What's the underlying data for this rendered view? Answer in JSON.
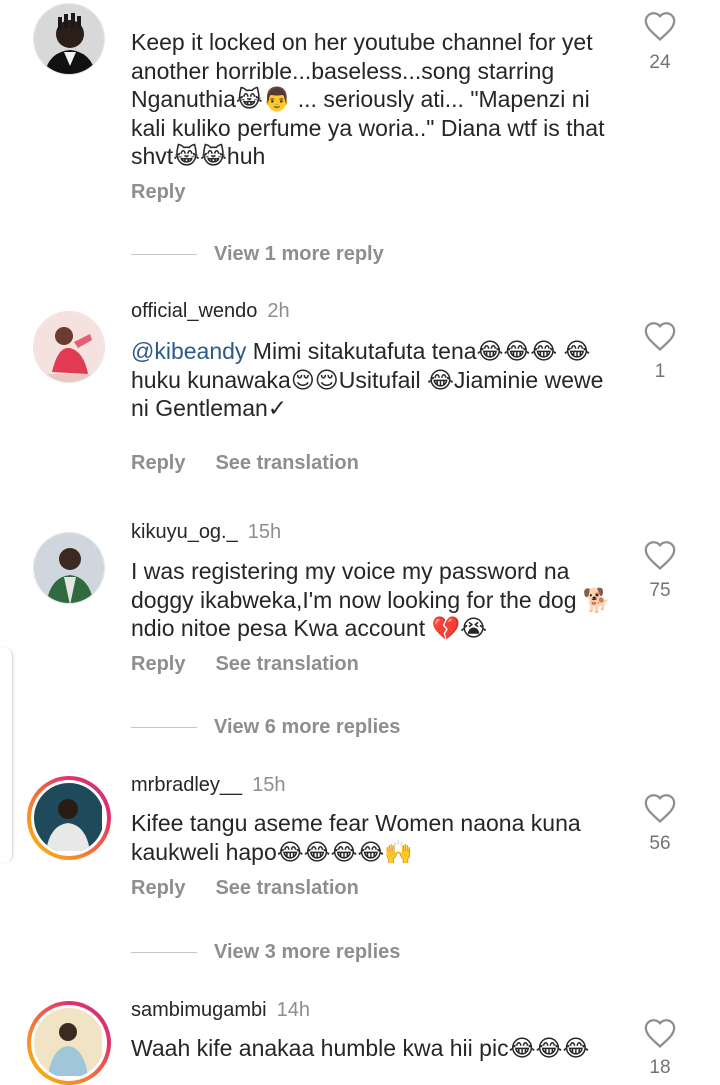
{
  "comments": [
    {
      "username": "",
      "time": "",
      "text": "Keep it locked on her youtube channel for yet another horrible...baseless...song starring Nganuthia😹👨 ... seriously ati... \"Mapenzi ni kali kuliko perfume ya woria..\" Diana wtf is that shvt😹😹huh",
      "likes": "24",
      "reply_label": "Reply",
      "translate_label": "",
      "view_more": "View 1 more reply"
    },
    {
      "username": "official_wendo",
      "time": "2h",
      "mention": "@kibeandy",
      "text": " Mimi sitakutafuta tena😂😂😂 😂 huku kunawaka😌😌Usitufail 😂Jiaminie wewe ni Gentleman✓",
      "likes": "1",
      "reply_label": "Reply",
      "translate_label": "See translation",
      "view_more": ""
    },
    {
      "username": "kikuyu_og._",
      "time": "15h",
      "text": "I was registering my voice my password na doggy ikabweka,I'm now looking for the dog 🐕 ndio nitoe pesa Kwa account 💔😭",
      "likes": "75",
      "reply_label": "Reply",
      "translate_label": "See translation",
      "view_more": "View 6 more replies"
    },
    {
      "username": "mrbradley__",
      "time": "15h",
      "text": "Kifee tangu aseme fear Women naona kuna kaukweli hapo😂😂😂😂🙌",
      "likes": "56",
      "reply_label": "Reply",
      "translate_label": "See translation",
      "view_more": "View 3 more replies"
    },
    {
      "username": "sambimugambi",
      "time": "14h",
      "text": "Waah kife anakaa humble kwa hii pic😂😂😂",
      "likes": "18",
      "reply_label": "",
      "translate_label": "",
      "view_more": ""
    }
  ],
  "icons": {
    "like": "heart-outline-icon",
    "avatar": "profile-picture"
  },
  "colors": {
    "text": "#262626",
    "secondary": "#8e8e8e",
    "mention": "#2e5a8a",
    "story_ring": [
      "#f9c300",
      "#f77737",
      "#e1306c",
      "#c13584"
    ]
  }
}
